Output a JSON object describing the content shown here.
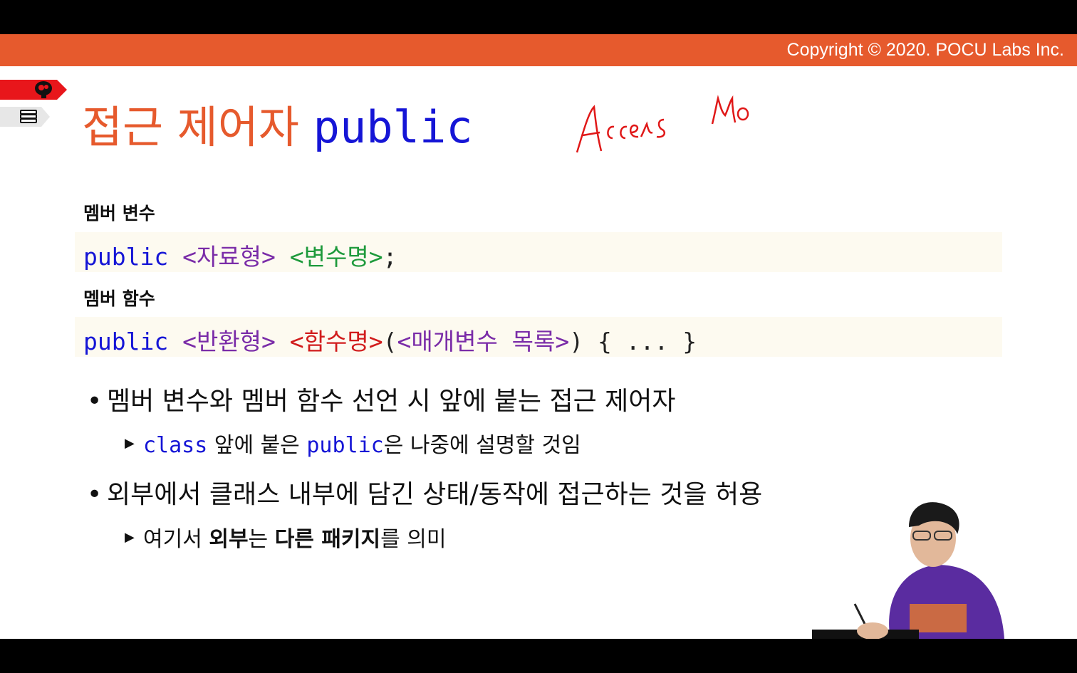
{
  "header": {
    "copyright": "Copyright © 2020. POCU Labs Inc.",
    "color": "#e65a2d"
  },
  "title": {
    "korean": "접근 제어자",
    "code": "public"
  },
  "handwriting": {
    "text": "Access Mo"
  },
  "member_variable": {
    "label": "멤버 변수",
    "kw": "public",
    "type": "<자료형>",
    "name": "<변수명>",
    "end": ";"
  },
  "member_function": {
    "label": "멤버 함수",
    "kw": "public",
    "return_type": "<반환형>",
    "name": "<함수명>",
    "open": "(",
    "params": "<매개변수 목록>",
    "rest": ") { ... }"
  },
  "bullets": [
    {
      "text": "멤버 변수와 멤버 함수 선언 시 앞에 붙는 접근 제어자",
      "sub": {
        "code1": "class",
        "t1": " 앞에 붙은 ",
        "code2": "public",
        "t2": "은 나중에 설명할 것임"
      }
    },
    {
      "text": "외부에서 클래스 내부에 담긴 상태/동작에 접근하는 것을 허용",
      "sub": {
        "t1": "여기서 ",
        "b1": "외부",
        "t2": "는 ",
        "b2": "다른 패키지",
        "t3": "를 의미"
      }
    }
  ],
  "icons": {
    "tag1": "brain-icon",
    "tag2": "books-icon",
    "bullet": "bullet-dot-icon",
    "sub": "triangle-right-icon"
  }
}
